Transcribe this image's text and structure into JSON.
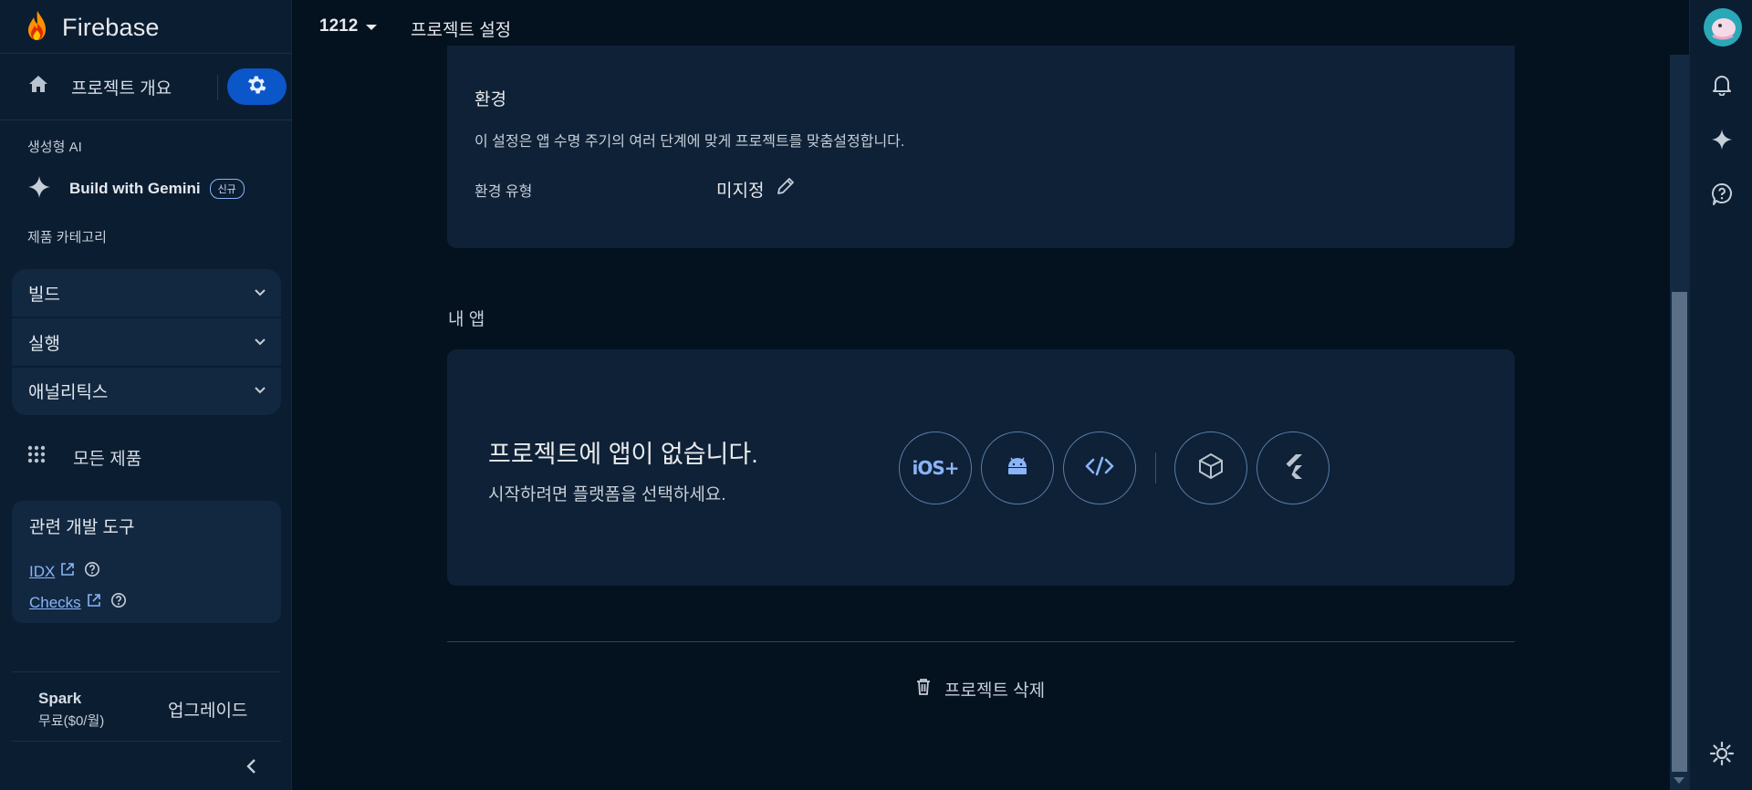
{
  "brand": {
    "name": "Firebase"
  },
  "sidebar": {
    "overview_label": "프로젝트 개요",
    "genai_section": "생성형 AI",
    "gemini_label": "Build with Gemini",
    "gemini_badge": "신규",
    "category_section": "제품 카테고리",
    "categories": [
      {
        "label": "빌드"
      },
      {
        "label": "실행"
      },
      {
        "label": "애널리틱스"
      }
    ],
    "all_products_label": "모든 제품",
    "dev_tools": {
      "title": "관련 개발 도구",
      "links": [
        {
          "label": "IDX"
        },
        {
          "label": "Checks"
        }
      ]
    },
    "plan": {
      "name": "Spark",
      "price": "무료($0/월)",
      "upgrade_label": "업그레이드"
    }
  },
  "header": {
    "project_name": "1212",
    "page_title": "프로젝트 설정"
  },
  "environment": {
    "title": "환경",
    "description": "이 설정은 앱 수명 주기의 여러 단계에 맞게 프로젝트를 맞춤설정합니다.",
    "type_label": "환경 유형",
    "type_value": "미지정"
  },
  "apps": {
    "section_label": "내 앱",
    "empty_title": "프로젝트에 앱이 없습니다.",
    "empty_subtitle": "시작하려면 플랫폼을 선택하세요.",
    "platforms": [
      {
        "icon": "ios-icon",
        "text": "iOS+"
      },
      {
        "icon": "android-icon"
      },
      {
        "icon": "web-code-icon"
      },
      {
        "icon": "unity-icon"
      },
      {
        "icon": "flutter-icon"
      }
    ]
  },
  "danger": {
    "delete_label": "프로젝트 삭제"
  },
  "colors": {
    "accent": "#0b56c9",
    "link": "#8ab4f8",
    "background": "#04121f",
    "surface": "#0e2136"
  }
}
